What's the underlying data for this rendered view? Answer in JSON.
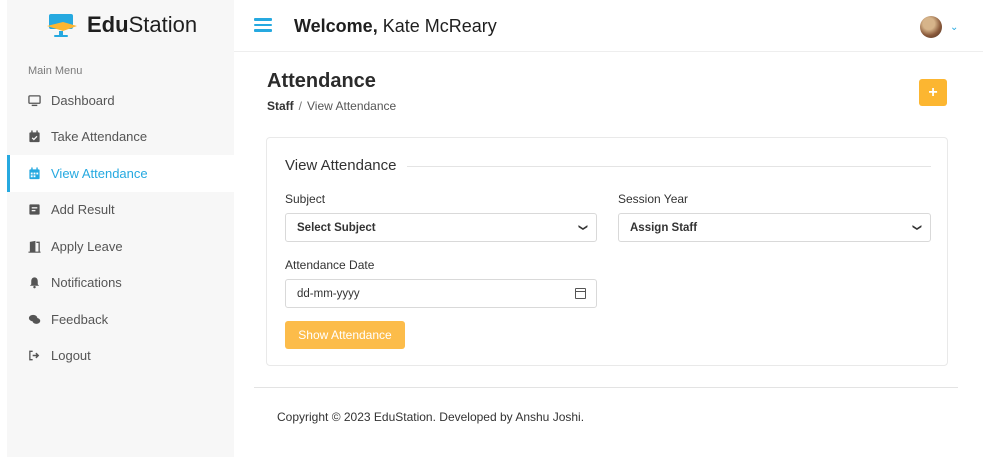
{
  "brand": {
    "name_bold": "Edu",
    "name_rest": "Station",
    "accent": "#26a9e0",
    "logo_colors": [
      "#26a9e0",
      "#fcb631"
    ]
  },
  "header": {
    "welcome_bold": "Welcome,",
    "user_name": "Kate McReary"
  },
  "sidebar": {
    "menu_title": "Main Menu",
    "items": [
      {
        "label": "Dashboard",
        "icon": "monitor-icon",
        "active": false
      },
      {
        "label": "Take Attendance",
        "icon": "calendar-check-icon",
        "active": false
      },
      {
        "label": "View Attendance",
        "icon": "calendar-icon",
        "active": true
      },
      {
        "label": "Add Result",
        "icon": "result-icon",
        "active": false
      },
      {
        "label": "Apply Leave",
        "icon": "door-open-icon",
        "active": false
      },
      {
        "label": "Notifications",
        "icon": "bell-icon",
        "active": false
      },
      {
        "label": "Feedback",
        "icon": "comments-icon",
        "active": false
      },
      {
        "label": "Logout",
        "icon": "sign-out-icon",
        "active": false
      }
    ]
  },
  "page": {
    "title": "Attendance",
    "breadcrumb": {
      "parent": "Staff",
      "separator": "/",
      "current": "View Attendance"
    },
    "add_button_label": "+",
    "button_color": "#fcb631"
  },
  "form": {
    "title": "View Attendance",
    "subject_label": "Subject",
    "subject_value": "Select Subject",
    "session_label": "Session Year",
    "session_value": "Assign Staff",
    "date_label": "Attendance Date",
    "date_value": "dd-mm-yyyy",
    "submit_label": "Show Attendance"
  },
  "footer": {
    "text": "Copyright © 2023 EduStation. Developed by Anshu Joshi."
  }
}
